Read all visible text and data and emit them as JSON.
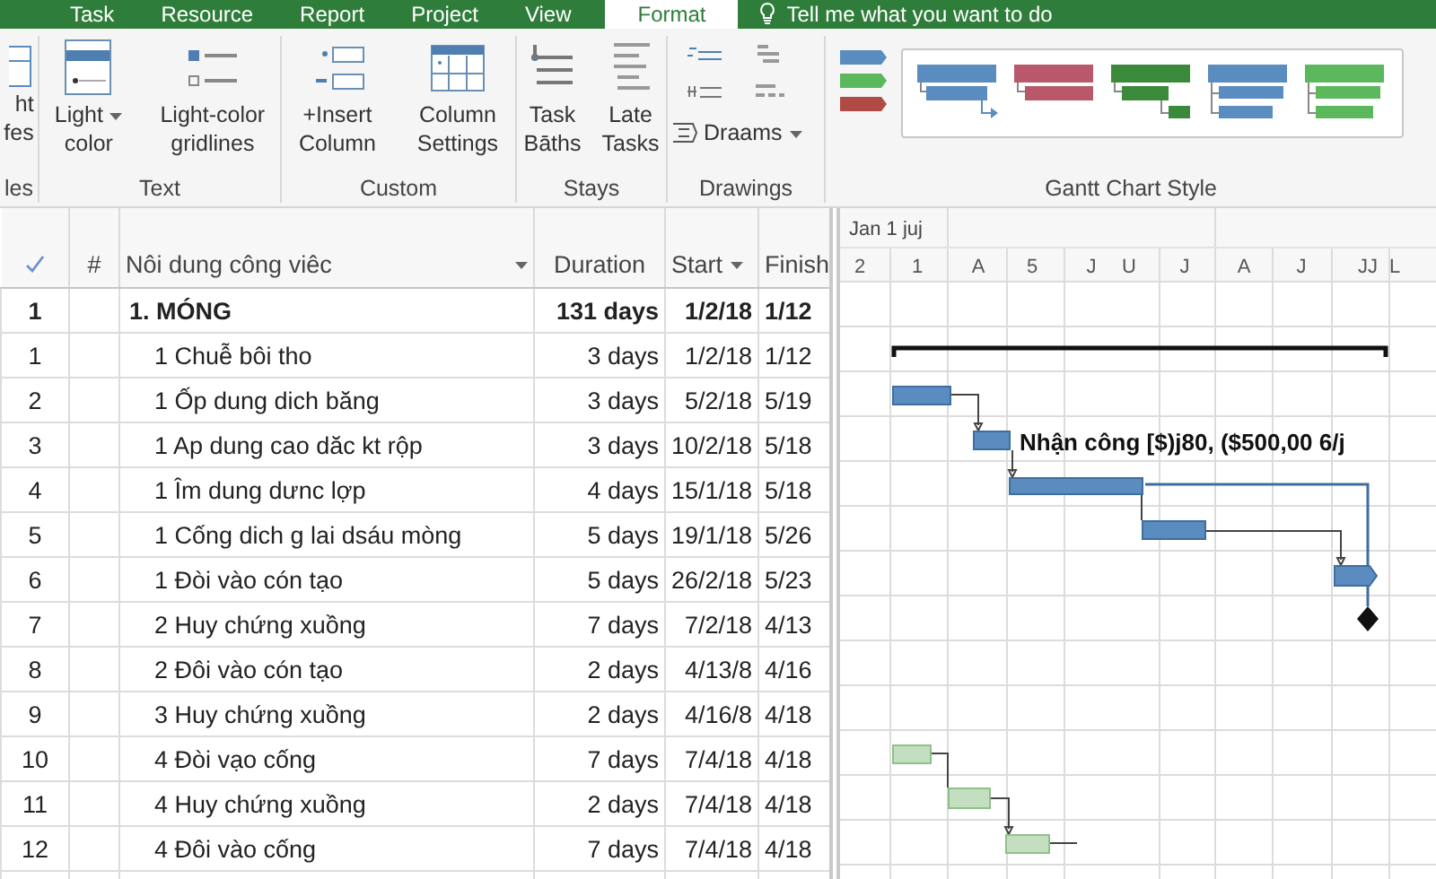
{
  "tabs": [
    {
      "label": "Task",
      "selected": false
    },
    {
      "label": "Resource",
      "selected": false
    },
    {
      "label": "Report",
      "selected": false
    },
    {
      "label": "Project",
      "selected": false
    },
    {
      "label": "View",
      "selected": false
    },
    {
      "label": "Format",
      "selected": true
    }
  ],
  "tell_me": "Tell me what you want to do",
  "ribbon": {
    "groups": [
      {
        "kind": "buttons",
        "label": "les",
        "buttons": [
          {
            "lines": [
              "ht",
              "fes"
            ],
            "dropdown": false
          }
        ]
      },
      {
        "kind": "buttons",
        "label": "Text",
        "buttons": [
          {
            "lines": [
              "Light",
              "color"
            ],
            "dropdown": true
          },
          {
            "lines": [
              "Light-color",
              "gridlines"
            ],
            "dropdown": false
          }
        ]
      },
      {
        "kind": "buttons",
        "label": "Custom",
        "buttons": [
          {
            "lines": [
              "+Insert",
              "Column"
            ],
            "dropdown": false
          },
          {
            "lines": [
              "Column",
              "Settings"
            ],
            "dropdown": false
          }
        ]
      },
      {
        "kind": "buttons",
        "label": "Stays",
        "buttons": [
          {
            "lines": [
              "Task",
              "Bāths"
            ],
            "dropdown": false
          },
          {
            "lines": [
              "Late",
              "Tasks"
            ],
            "dropdown": false
          }
        ]
      },
      {
        "kind": "drawings",
        "label": "Drawings",
        "buttons": [
          {
            "lines": [
              "Draams"
            ],
            "dropdown": true
          }
        ]
      },
      {
        "kind": "gallery",
        "label": "Gantt Chart Style",
        "presets": [
          {
            "color": "#5b8cc0"
          },
          {
            "color": "#5cb85c"
          },
          {
            "color": "#b04a45"
          }
        ],
        "styles": [
          {
            "color": "#5b8cc0"
          },
          {
            "color": "#b8586a"
          },
          {
            "color": "#3b8a3b"
          },
          {
            "color": "#5b8cc0"
          },
          {
            "color": "#5cb85c"
          }
        ]
      }
    ]
  },
  "table": {
    "columns": [
      "#",
      "Nôi dung công viêc",
      "Duration",
      "Start",
      "Finish"
    ],
    "rows": [
      {
        "id": "1",
        "name": "1. MÓNG",
        "duration": "131 days",
        "start": "1/2/18",
        "finish": "1/12",
        "children": [
          {
            "id": "1",
            "name": "1 Chuễ bôi tho",
            "duration": "3 days",
            "start": "1/2/18",
            "finish": "1/12"
          },
          {
            "id": "2",
            "name": "1 Ốp dung dich băng",
            "duration": "3 days",
            "start": "5/2/18",
            "finish": "5/19"
          },
          {
            "id": "3",
            "name": "1 Ap dung cao dăc kt rộp",
            "duration": "3 days",
            "start": "10/2/18",
            "finish": "5/18"
          },
          {
            "id": "4",
            "name": "1 Îm dung dưnc lợp",
            "duration": "4 days",
            "start": "15/1/18",
            "finish": "5/18"
          },
          {
            "id": "5",
            "name": "1 Cống dich g lai dsáu mòng",
            "duration": "5 days",
            "start": "19/1/18",
            "finish": "5/26"
          },
          {
            "id": "6",
            "name": "1 Đòi vào cón tạo",
            "duration": "5 days",
            "start": "26/2/18",
            "finish": "5/23"
          },
          {
            "id": "7",
            "name": "2 Huy chứng xuồng",
            "duration": "7 days",
            "start": "7/2/18",
            "finish": "4/13"
          },
          {
            "id": "8",
            "name": "2 Đôi vào cón tạo",
            "duration": "2 days",
            "start": "4/13/8",
            "finish": "4/16"
          },
          {
            "id": "9",
            "name": "3 Huy chứng xuồng",
            "duration": "2 days",
            "start": "4/16/8",
            "finish": "4/18"
          },
          {
            "id": "10",
            "name": "4 Đòi vạo cống",
            "duration": "7 days",
            "start": "7/4/18",
            "finish": "4/18"
          },
          {
            "id": "11",
            "name": "4 Huy chứng xuồng",
            "duration": "2 days",
            "start": "7/4/18",
            "finish": "4/18"
          },
          {
            "id": "12",
            "name": "4 Đôi vào cống",
            "duration": "7 days",
            "start": "7/4/18",
            "finish": "4/18"
          }
        ]
      }
    ]
  },
  "gantt": {
    "timescale_top": "Jan 1 juj",
    "timescale_units": [
      "2",
      "1",
      "A",
      "5",
      "J",
      "U",
      "J",
      "A",
      "J",
      "JJ",
      "L"
    ],
    "bar_label": "Nhận công [$)j80, ($500,00 6/j"
  }
}
